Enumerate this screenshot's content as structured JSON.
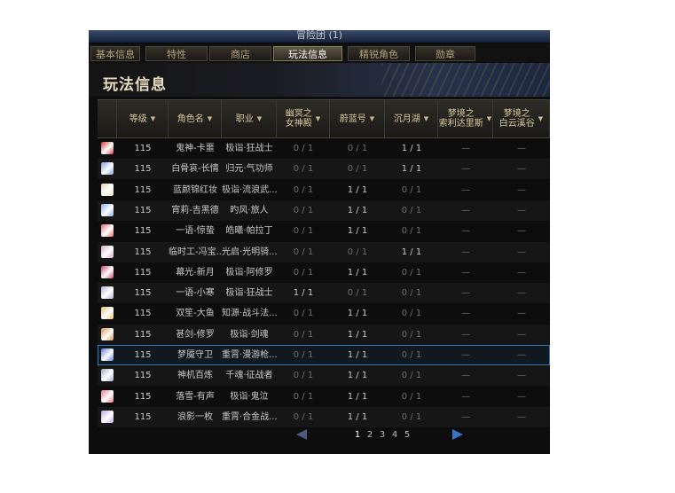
{
  "window": {
    "title": "冒险团 (1)"
  },
  "tabs": [
    {
      "label": "基本信息",
      "active": false
    },
    {
      "label": "特性",
      "active": false
    },
    {
      "label": "商店",
      "active": false
    },
    {
      "label": "玩法信息",
      "active": true
    },
    {
      "label": "精锐角色",
      "active": false
    },
    {
      "label": "勋章",
      "active": false
    }
  ],
  "section_title": "玩法信息",
  "columns": [
    {
      "line1": "",
      "line2": "",
      "sortable": false
    },
    {
      "line1": "等级",
      "line2": "",
      "sortable": true
    },
    {
      "line1": "角色名",
      "line2": "",
      "sortable": true
    },
    {
      "line1": "职业",
      "line2": "",
      "sortable": true
    },
    {
      "line1": "幽冥之",
      "line2": "女神殿",
      "sortable": true
    },
    {
      "line1": "蔚蓝号",
      "line2": "",
      "sortable": true
    },
    {
      "line1": "沉月湖",
      "line2": "",
      "sortable": true
    },
    {
      "line1": "梦境之",
      "line2": "索利达里斯",
      "sortable": true
    },
    {
      "line1": "梦境之",
      "line2": "白云溪谷",
      "sortable": true
    }
  ],
  "avatar_colors": [
    "#c83a3a",
    "#7aa0d8",
    "#e8d8b0",
    "#8ab0e8",
    "#e86a7a",
    "#d8a8c8",
    "#c84a6a",
    "#b8b0d8",
    "#e8c070",
    "#d89050",
    "#5a7ad8",
    "#a0a8c8",
    "#e87a8a",
    "#b8a8e8"
  ],
  "rows": [
    {
      "level": "115",
      "name": "鬼神-卡噩",
      "job": "极诣·狂战士",
      "c1": "0 / 1",
      "c2": "0 / 1",
      "c3": "1 / 1",
      "c4": "—",
      "c5": "—"
    },
    {
      "level": "115",
      "name": "白骨哀-长情",
      "job": "归元·气功师",
      "c1": "0 / 1",
      "c2": "0 / 1",
      "c3": "1 / 1",
      "c4": "—",
      "c5": "—"
    },
    {
      "level": "115",
      "name": "蓝颜锦红妆",
      "job": "极诣·流浪武...",
      "c1": "0 / 1",
      "c2": "1 / 1",
      "c3": "0 / 1",
      "c4": "—",
      "c5": "—"
    },
    {
      "level": "115",
      "name": "宵莉-吉黑德",
      "job": "旳风·旅人",
      "c1": "0 / 1",
      "c2": "1 / 1",
      "c3": "0 / 1",
      "c4": "—",
      "c5": "—"
    },
    {
      "level": "115",
      "name": "一语-惊蛰",
      "job": "皓曦·帕拉丁",
      "c1": "0 / 1",
      "c2": "1 / 1",
      "c3": "0 / 1",
      "c4": "—",
      "c5": "—"
    },
    {
      "level": "115",
      "name": "临时工-冯宝...",
      "job": "光启·光明骑...",
      "c1": "0 / 1",
      "c2": "0 / 1",
      "c3": "1 / 1",
      "c4": "—",
      "c5": "—"
    },
    {
      "level": "115",
      "name": "幕光-新月",
      "job": "极诣·阿修罗",
      "c1": "0 / 1",
      "c2": "1 / 1",
      "c3": "0 / 1",
      "c4": "—",
      "c5": "—"
    },
    {
      "level": "115",
      "name": "一语-小寒",
      "job": "极诣·狂战士",
      "c1": "1 / 1",
      "c2": "0 / 1",
      "c3": "0 / 1",
      "c4": "—",
      "c5": "—"
    },
    {
      "level": "115",
      "name": "双笙-大鱼",
      "job": "知源·战斗法...",
      "c1": "0 / 1",
      "c2": "1 / 1",
      "c3": "0 / 1",
      "c4": "—",
      "c5": "—"
    },
    {
      "level": "115",
      "name": "甚剑-修罗",
      "job": "极诣·剑魂",
      "c1": "0 / 1",
      "c2": "1 / 1",
      "c3": "0 / 1",
      "c4": "—",
      "c5": "—"
    },
    {
      "level": "115",
      "name": "梦魇守卫",
      "job": "重霄·漫游枪...",
      "c1": "0 / 1",
      "c2": "1 / 1",
      "c3": "0 / 1",
      "c4": "—",
      "c5": "—"
    },
    {
      "level": "115",
      "name": "神机百炼",
      "job": "千魂·征战者",
      "c1": "0 / 1",
      "c2": "1 / 1",
      "c3": "0 / 1",
      "c4": "—",
      "c5": "—"
    },
    {
      "level": "115",
      "name": "落雪-有声",
      "job": "极诣·鬼泣",
      "c1": "0 / 1",
      "c2": "1 / 1",
      "c3": "0 / 1",
      "c4": "—",
      "c5": "—"
    },
    {
      "level": "115",
      "name": "浪影一枚",
      "job": "重霄·合金战...",
      "c1": "0 / 1",
      "c2": "1 / 1",
      "c3": "0 / 1",
      "c4": "—",
      "c5": "—"
    }
  ],
  "selected_row": 10,
  "pagination": {
    "pages": [
      "1",
      "2",
      "3",
      "4",
      "5"
    ],
    "current": "1"
  }
}
